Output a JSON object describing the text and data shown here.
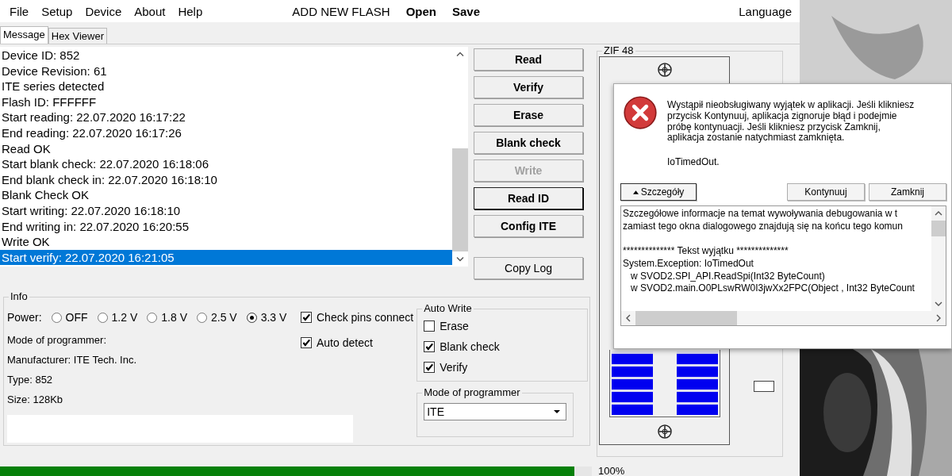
{
  "menu": [
    "File",
    "Setup",
    "Device",
    "About",
    "Help"
  ],
  "toolbar": [
    {
      "label": "ADD NEW FLASH",
      "bold": false
    },
    {
      "label": "Open",
      "bold": true
    },
    {
      "label": "Save",
      "bold": true
    }
  ],
  "language": "Language",
  "tabs": [
    {
      "label": "Message",
      "selected": true
    },
    {
      "label": "Hex Viewer",
      "selected": false
    }
  ],
  "log": [
    {
      "text": "Device ID: 852",
      "selected": false
    },
    {
      "text": "Device Revision: 61",
      "selected": false
    },
    {
      "text": "ITE series detected",
      "selected": false
    },
    {
      "text": "Flash ID: FFFFFF",
      "selected": false
    },
    {
      "text": "Start reading: 22.07.2020 16:17:22",
      "selected": false
    },
    {
      "text": "End reading: 22.07.2020 16:17:26",
      "selected": false
    },
    {
      "text": "Read OK",
      "selected": false
    },
    {
      "text": "Start blank check: 22.07.2020 16:18:06",
      "selected": false
    },
    {
      "text": "End blank check in: 22.07.2020 16:18:10",
      "selected": false
    },
    {
      "text": "Blank Check OK",
      "selected": false
    },
    {
      "text": "Start writing: 22.07.2020 16:18:10",
      "selected": false
    },
    {
      "text": "End writing in: 22.07.2020 16:20:55",
      "selected": false
    },
    {
      "text": "Write OK",
      "selected": false
    },
    {
      "text": "Start verify: 22.07.2020 16:21:05",
      "selected": true
    }
  ],
  "buttons": [
    {
      "label": "Read",
      "disabled": false,
      "focused": false
    },
    {
      "label": "Verify",
      "disabled": false,
      "focused": false
    },
    {
      "label": "Erase",
      "disabled": false,
      "focused": false
    },
    {
      "label": "Blank check",
      "disabled": false,
      "focused": false
    },
    {
      "label": "Write",
      "disabled": true,
      "focused": false
    },
    {
      "label": "Read ID",
      "disabled": false,
      "focused": true
    },
    {
      "label": "Config ITE",
      "disabled": false,
      "focused": false
    }
  ],
  "copy_log": "Copy Log",
  "info": {
    "title": "Info",
    "power_label": "Power:",
    "power": [
      {
        "label": "OFF",
        "selected": false
      },
      {
        "label": "1.2 V",
        "selected": false
      },
      {
        "label": "1.8 V",
        "selected": false
      },
      {
        "label": "2.5 V",
        "selected": false
      },
      {
        "label": "3.3 V",
        "selected": true
      }
    ],
    "lines": [
      "Mode of programmer:",
      "Manufacturer: ITE Tech. Inc.",
      "Type: 852",
      "Size: 128Kb"
    ],
    "options": [
      {
        "label": "Check pins connect",
        "checked": true
      },
      {
        "label": "Auto detect",
        "checked": true
      }
    ],
    "auto_write": {
      "title": "Auto Write",
      "items": [
        {
          "label": "Erase",
          "checked": false
        },
        {
          "label": "Blank check",
          "checked": true
        },
        {
          "label": "Verify",
          "checked": true
        }
      ]
    },
    "mode": {
      "title": "Mode of programmer",
      "value": "ITE"
    }
  },
  "zif": {
    "title": "ZIF 48"
  },
  "progress": {
    "level": 0.97,
    "reading": "100%"
  },
  "dialog": {
    "message": "Wystąpił nieobsługiwany wyjątek w aplikacji. Jeśli klikniesz przycisk Kontynuuj, aplikacja zignoruje błąd i podejmie próbę kontynuacji. Jeśli klikniesz przycisk Zamknij, aplikacja zostanie natychmiast zamknięta.",
    "error": "IoTimedOut.",
    "details_button": "Szczegóły",
    "buttons": [
      "Kontynuuj",
      "Zamknij"
    ],
    "details": {
      "intro": [
        "Szczegółowe informacje na temat wywoływania debugowania w t",
        "zamiast tego okna dialogowego znajdują się na końcu tego komun"
      ],
      "exception": [
        "************** Tekst wyjątku **************",
        "System.Exception: IoTimedOut",
        "   w SVOD2.SPI_API.ReadSpi(Int32 ByteCount)",
        "   w SVOD2.main.O0PLswRW0I3jwXx2FPC(Object , Int32 ByteCount"
      ]
    }
  }
}
